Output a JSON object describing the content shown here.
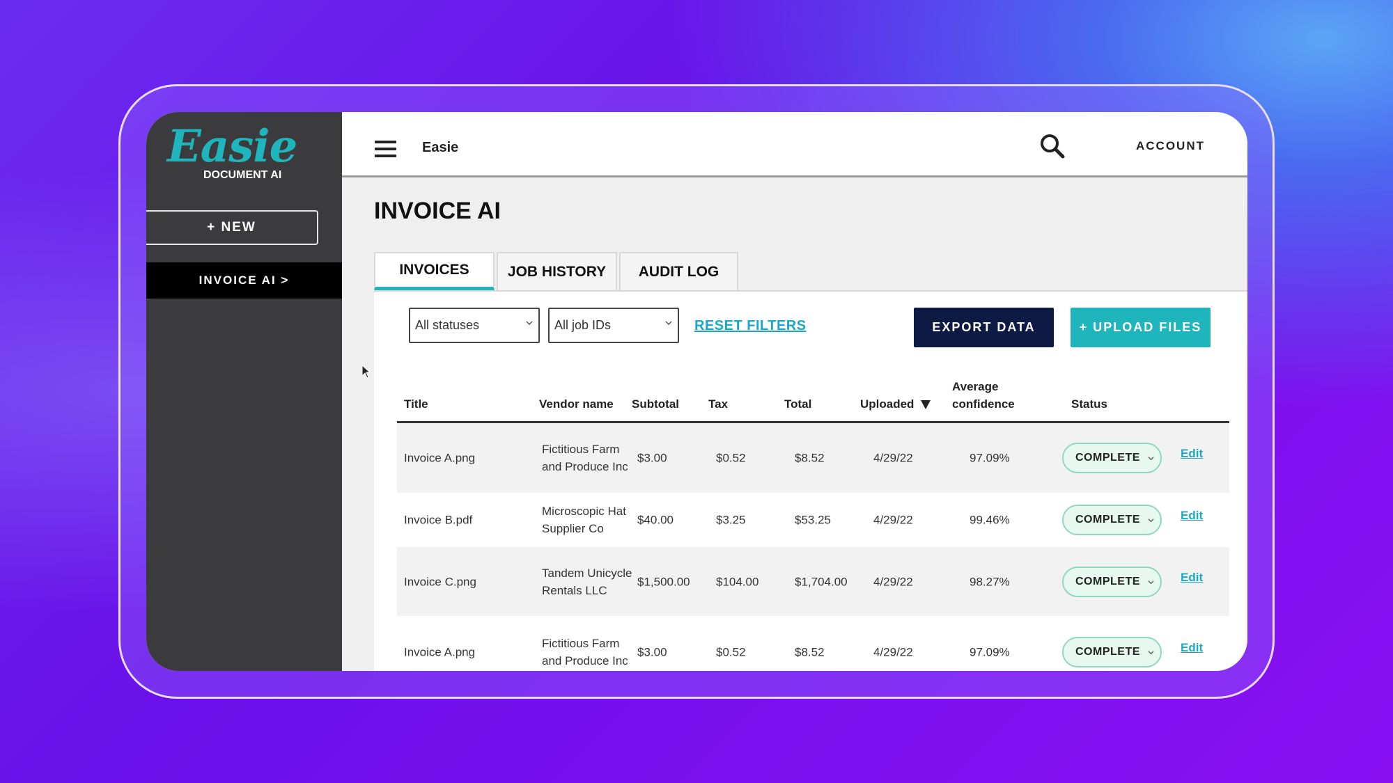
{
  "sidebar": {
    "logo_script": "Easie",
    "logo_sub": "DOCUMENT AI",
    "new_label": "+ NEW",
    "nav_item": "INVOICE AI >"
  },
  "topbar": {
    "brand": "Easie",
    "account": "ACCOUNT"
  },
  "page": {
    "title": "INVOICE AI"
  },
  "tabs": [
    "INVOICES",
    "JOB HISTORY",
    "AUDIT LOG"
  ],
  "filters": {
    "status_select": "All statuses",
    "jobs_select": "All job IDs",
    "reset": "RESET FILTERS"
  },
  "actions": {
    "export": "EXPORT DATA",
    "upload": "+ UPLOAD FILES"
  },
  "table": {
    "headers": {
      "title": "Title",
      "vendor": "Vendor name",
      "subtotal": "Subtotal",
      "tax": "Tax",
      "total": "Total",
      "uploaded": "Uploaded",
      "confidence_1": "Average",
      "confidence_2": "confidence",
      "status": "Status"
    },
    "rows": [
      {
        "title": "Invoice A.png",
        "vendor": "Fictitious Farm and Produce Inc",
        "subtotal": "$3.00",
        "tax": "$0.52",
        "total": "$8.52",
        "uploaded": "4/29/22",
        "confidence": "97.09%",
        "status": "COMPLETE",
        "edit": "Edit"
      },
      {
        "title": "Invoice B.pdf",
        "vendor": "Microscopic Hat Supplier Co",
        "subtotal": "$40.00",
        "tax": "$3.25",
        "total": "$53.25",
        "uploaded": "4/29/22",
        "confidence": "99.46%",
        "status": "COMPLETE",
        "edit": "Edit"
      },
      {
        "title": "Invoice C.png",
        "vendor": "Tandem Unicycle Rentals LLC",
        "subtotal": "$1,500.00",
        "tax": "$104.00",
        "total": "$1,704.00",
        "uploaded": "4/29/22",
        "confidence": "98.27%",
        "status": "COMPLETE",
        "edit": "Edit"
      },
      {
        "title": "Invoice A.png",
        "vendor": "Fictitious Farm and Produce Inc",
        "subtotal": "$3.00",
        "tax": "$0.52",
        "total": "$8.52",
        "uploaded": "4/29/22",
        "confidence": "97.09%",
        "status": "COMPLETE",
        "edit": "Edit"
      }
    ]
  },
  "colors": {
    "accent": "#1fb5bd",
    "navy": "#0d1a44",
    "sidebar": "#3b3b3d",
    "status_bg": "#e7f8f1",
    "status_border": "#8fd7c0"
  },
  "icons": [
    "hamburger-icon",
    "search-icon",
    "chevron-down-icon",
    "sort-down-icon",
    "cursor-icon"
  ]
}
